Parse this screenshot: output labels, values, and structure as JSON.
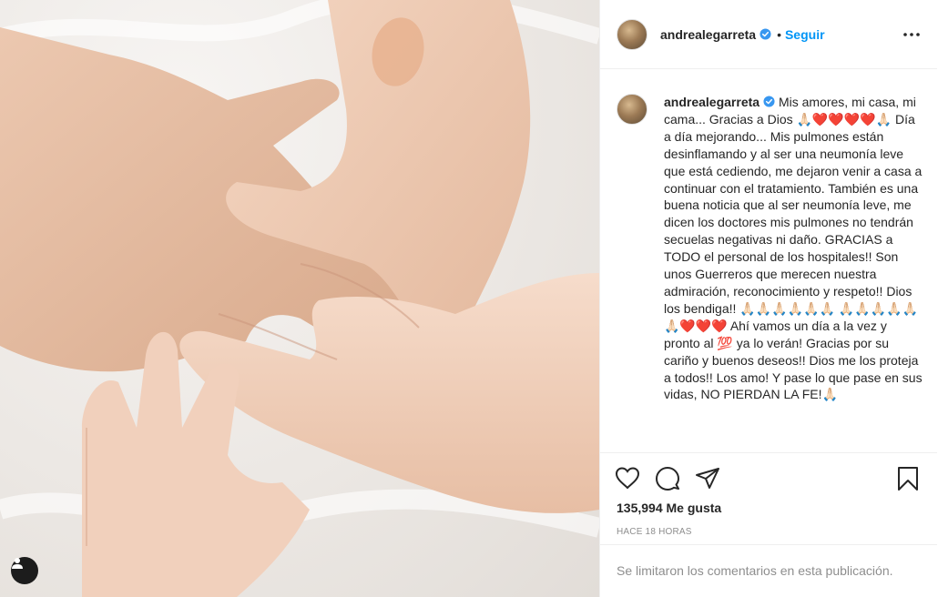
{
  "post": {
    "username": "andrealegarreta",
    "follow_label": "Seguir",
    "separator": "•",
    "caption": "Mis amores, mi casa, mi cama... Gracias a Dios 🙏🏻❤️❤️❤️❤️🙏🏻 Día a día mejorando... Mis pulmones están desinflamando y al ser una neumonía leve que está cediendo, me dejaron venir a casa a continuar con el tratamiento. También es una buena noticia que al ser neumonía leve, me dicen los doctores mis pulmones no tendrán secuelas negativas ni daño. GRACIAS a TODO el personal de los hospitales!! Son unos Guerreros que merecen nuestra admiración, reconocimiento y respeto!! Dios los bendiga!! 🙏🏻🙏🏻🙏🏻🙏🏻🙏🏻🙏🏻 🙏🏻🙏🏻🙏🏻🙏🏻🙏🏻🙏🏻❤️❤️❤️ Ahí vamos un día a la vez y pronto al 💯 ya lo verán! Gracias por su cariño y buenos deseos!! Dios me los proteja a todos!! Los amo! Y pase lo que pase en sus vidas, NO PIERDAN LA FE!🙏🏻",
    "likes_label": "135,994 Me gusta",
    "timestamp": "Hace 18 horas",
    "comments_disabled": "Se limitaron los comentarios en esta publicación."
  },
  "icons": {
    "like": "heart-icon",
    "comment": "comment-icon",
    "share": "paper-plane-icon",
    "save": "bookmark-icon",
    "more": "more-options-icon",
    "verified": "verified-badge-icon",
    "user_tag": "user-tag-icon"
  },
  "colors": {
    "accent": "#0095f6",
    "text": "#262626",
    "muted": "#8e8e8e",
    "border": "#efefef",
    "heart": "#c00000"
  }
}
